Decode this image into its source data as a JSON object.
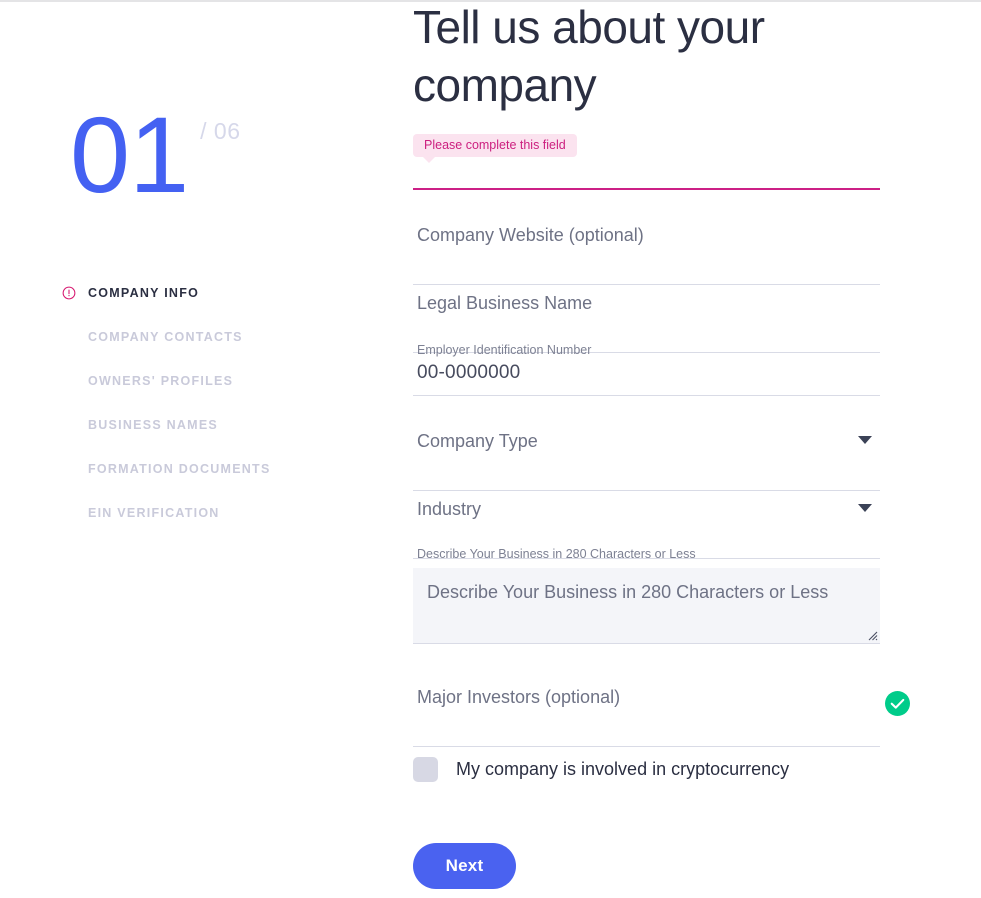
{
  "sidebar": {
    "step": {
      "current": "01",
      "total": "/ 06"
    },
    "items": [
      {
        "label": "COMPANY INFO",
        "state": "active-error",
        "icon": "alert-circle-icon"
      },
      {
        "label": "COMPANY CONTACTS",
        "state": "inactive",
        "icon": ""
      },
      {
        "label": "OWNERS' PROFILES",
        "state": "inactive",
        "icon": ""
      },
      {
        "label": "BUSINESS NAMES",
        "state": "inactive",
        "icon": ""
      },
      {
        "label": "FORMATION DOCUMENTS",
        "state": "inactive",
        "icon": ""
      },
      {
        "label": "EIN VERIFICATION",
        "state": "inactive",
        "icon": ""
      }
    ]
  },
  "main": {
    "title": "Tell us about your company",
    "error_tooltip": "Please complete this field",
    "fields": {
      "company_name": {
        "value": "",
        "placeholder": "",
        "state": "error"
      },
      "website": {
        "placeholder": "Company Website (optional)",
        "value": ""
      },
      "legal_name": {
        "placeholder": "Legal Business Name",
        "value": ""
      },
      "ein": {
        "label": "Employer Identification Number",
        "value": "00-0000000"
      },
      "company_type": {
        "placeholder": "Company Type",
        "value": ""
      },
      "industry": {
        "placeholder": "Industry",
        "value": ""
      },
      "describe": {
        "label": "Describe Your Business in 280 Characters or Less",
        "placeholder": "Describe Your Business in 280 Characters or Less",
        "value": ""
      },
      "investors": {
        "placeholder": "Major Investors (optional)",
        "value": "",
        "status": "valid"
      }
    },
    "crypto_checkbox": {
      "label": "My company is involved in cryptocurrency",
      "checked": false
    },
    "next_button": "Next"
  },
  "colors": {
    "accent_blue": "#4461f2",
    "button_blue": "#4a62f0",
    "error_magenta": "#cc2086",
    "error_tooltip_bg": "#fbe3ef",
    "success_green": "#00cc8a",
    "nav_inactive": "#c9cada",
    "nav_active": "#2b2f42",
    "step_total_gray": "#d6d8ea",
    "underline_gray": "#d9dbe6",
    "textarea_bg": "#f4f5f9",
    "checkbox_gray": "#d7d8e4"
  }
}
